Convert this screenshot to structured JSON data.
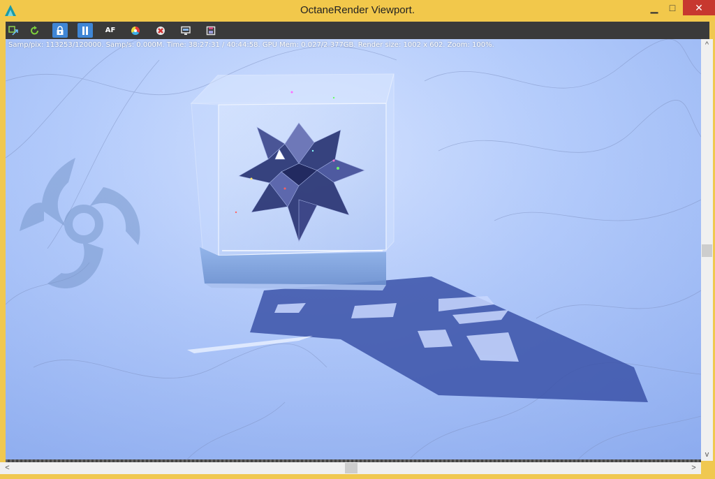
{
  "window": {
    "title": "OctaneRender Viewport.",
    "minimize_glyph": "▁",
    "maximize_glyph": "□",
    "close_glyph": "✕"
  },
  "toolbar": {
    "buttons": [
      {
        "icon": "send-to-viewport-icon",
        "active": false
      },
      {
        "icon": "restart-render-icon",
        "active": false
      },
      {
        "icon": "lock-icon",
        "active": true
      },
      {
        "icon": "pause-icon",
        "active": true
      },
      {
        "icon": "autofocus-icon",
        "label": "AF",
        "active": false
      },
      {
        "icon": "color-picker-icon",
        "active": false
      },
      {
        "icon": "clear-icon",
        "active": false
      },
      {
        "icon": "display-settings-icon",
        "active": false
      },
      {
        "icon": "save-image-icon",
        "active": false
      }
    ]
  },
  "status": {
    "text": "Samp/pix: 113253/120000.   Samp/s: 0.000M.   Time: 38:27:31 / 40:44:58.   GPU Mem: 0.027/2.377GB.   Render size: 1002 x 602.   Zoom: 100%."
  },
  "colors": {
    "titlebar": "#f2c84b",
    "toolbar": "#3a3a3a",
    "active_button": "#3f86d6",
    "close_button": "#c7382f",
    "render_background": "#b3cbfb"
  },
  "scroll": {
    "left_arrow": "<",
    "right_arrow": ">",
    "up_arrow": "^",
    "down_arrow": "v"
  }
}
